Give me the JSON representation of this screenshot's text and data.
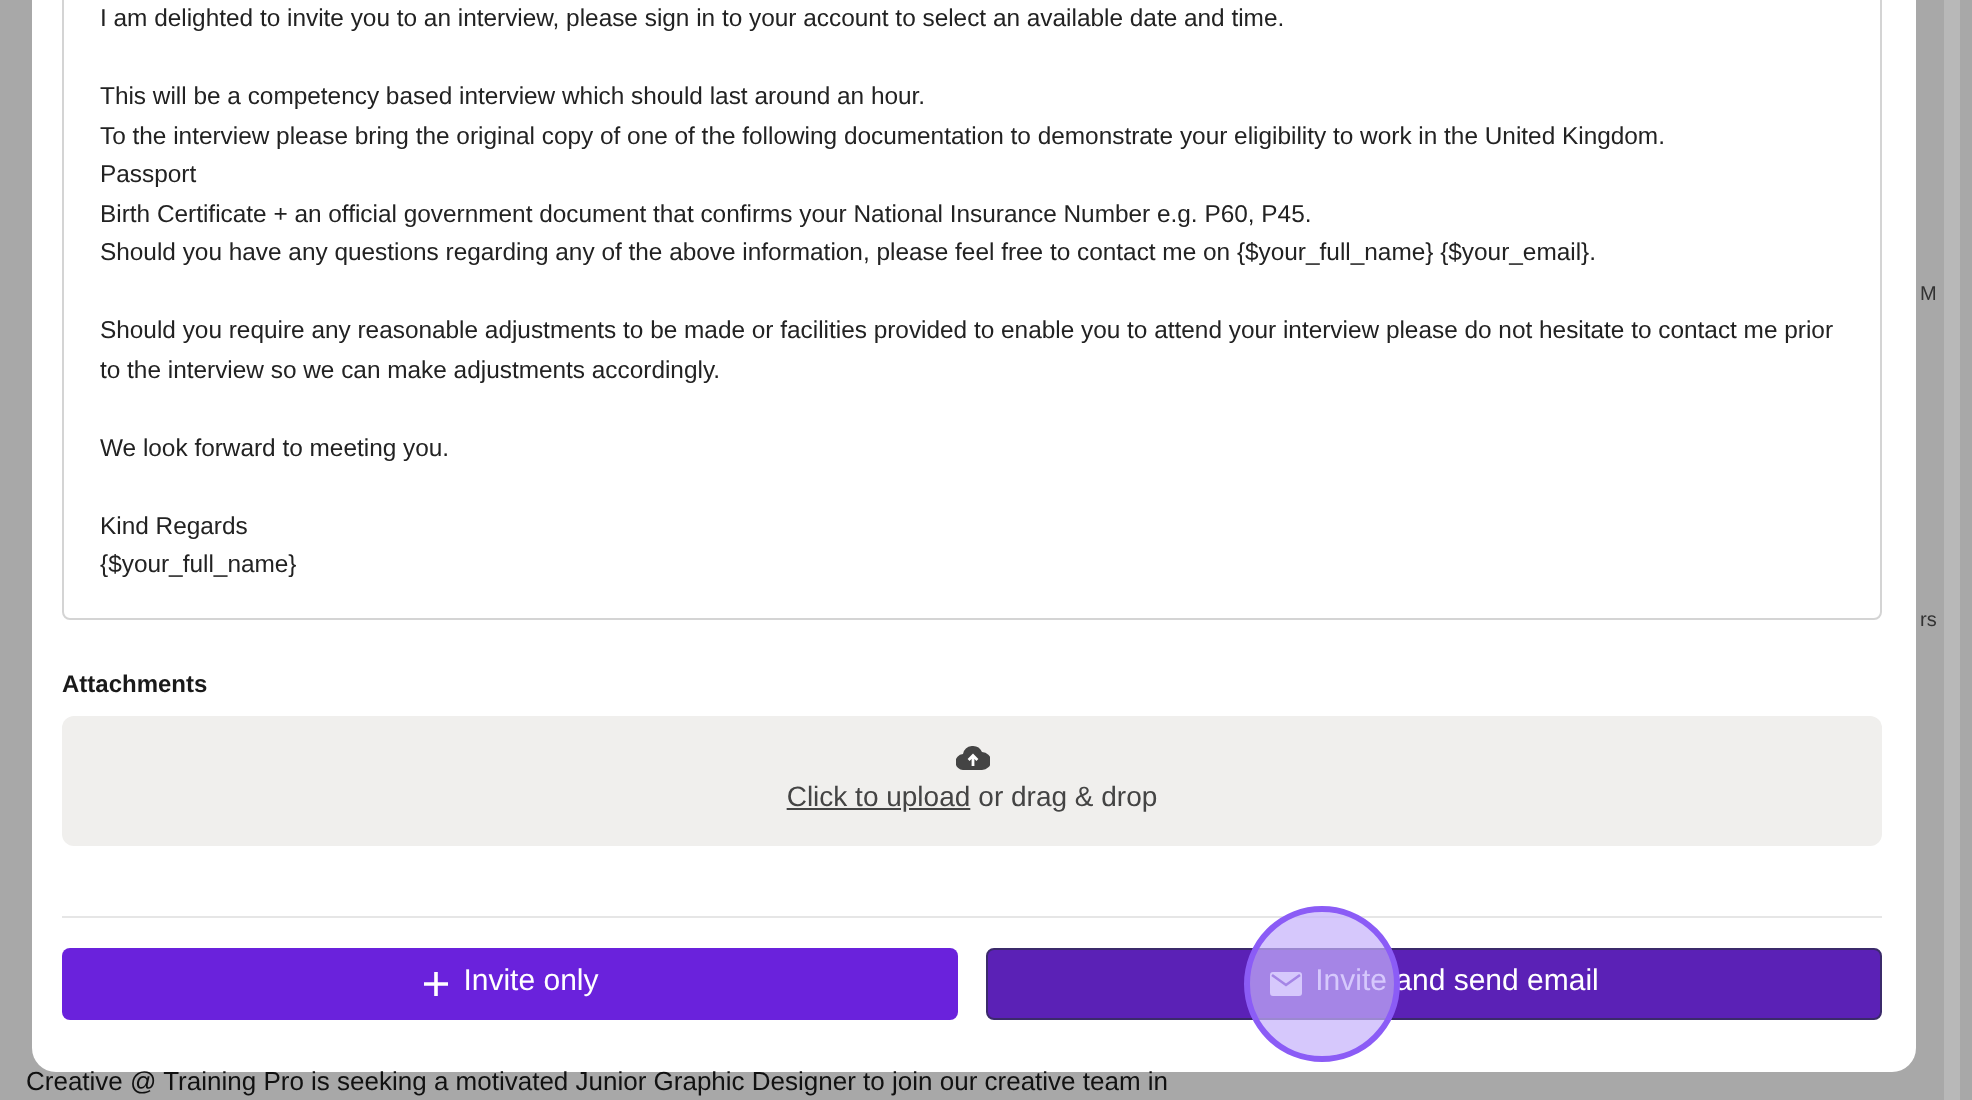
{
  "email_body": {
    "paragraphs": [
      [
        "I am delighted to invite you to an interview, please sign in to your account to select an available date and time."
      ],
      [
        "This will be a competency based interview which should last around an hour.",
        "To the interview please bring the original copy of one of the following documentation to demonstrate your eligibility to work in the United Kingdom.",
        "Passport",
        "Birth Certificate + an official government document that confirms your National Insurance Number e.g. P60, P45.",
        "Should you have any questions regarding any of the above information, please feel free to contact me on {$your_full_name} {$your_email}."
      ],
      [
        "Should you require any reasonable adjustments to be made or facilities provided to enable you to attend your interview please do not hesitate to contact me prior to the interview so we can make adjustments accordingly."
      ],
      [
        "We look forward to meeting you."
      ],
      [
        "Kind Regards",
        "{$your_full_name}"
      ]
    ]
  },
  "attachments": {
    "label": "Attachments",
    "upload_link": "Click to upload",
    "upload_hint": "or drag & drop"
  },
  "buttons": [
    {
      "kind": "plus",
      "label": "Invite only",
      "highlighted": false
    },
    {
      "kind": "mail",
      "label": "Invite and send email",
      "highlighted": true
    }
  ],
  "background": {
    "text": "Creative @ Training Pro is seeking a motivated Junior Graphic Designer to join our creative team in",
    "fragments": [
      "M",
      "rs"
    ]
  }
}
